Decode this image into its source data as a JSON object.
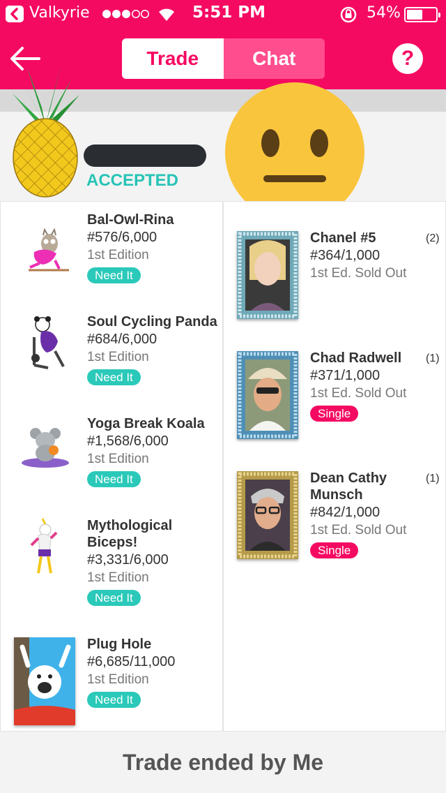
{
  "status_bar": {
    "carrier": "Valkyrie",
    "time": "5:51 PM",
    "battery": "54%",
    "battery_level": 0.54,
    "icons": [
      "back-to-app-icon",
      "signal-dots-icon",
      "wifi-icon",
      "orientation-lock-icon",
      "battery-icon"
    ]
  },
  "nav": {
    "back_icon": "back-arrow-icon",
    "tabs": [
      {
        "label": "Trade",
        "active": true
      },
      {
        "label": "Chat",
        "active": false
      }
    ],
    "help_label": "?"
  },
  "header": {
    "avatar_icon": "pineapple-avatar",
    "status": "ACCEPTED",
    "status_color": "#27c4b6",
    "reaction_icon": "neutral-face-emoji"
  },
  "left_items": [
    {
      "title": "Bal-Owl-Rina",
      "number": "#576/6,000",
      "edition": "1st Edition",
      "badge": "Need It"
    },
    {
      "title": "Soul Cycling Panda",
      "number": "#684/6,000",
      "edition": "1st Edition",
      "badge": "Need It"
    },
    {
      "title": "Yoga Break Koala",
      "number": "#1,568/6,000",
      "edition": "1st Edition",
      "badge": "Need It"
    },
    {
      "title": "Mythological",
      "title2": "Biceps!",
      "number": "#3,331/6,000",
      "edition": "1st Edition",
      "badge": "Need It"
    },
    {
      "title": "Plug Hole",
      "number": "#6,685/11,000",
      "edition": "1st Edition",
      "badge": "Need It"
    }
  ],
  "right_items": [
    {
      "title": "Chanel #5",
      "count": "(2)",
      "number": "#364/1,000",
      "edition": "1st Ed. Sold Out"
    },
    {
      "title": "Chad Radwell",
      "count": "(1)",
      "number": "#371/1,000",
      "edition": "1st Ed. Sold Out",
      "badge": "Single"
    },
    {
      "title": "Dean Cathy",
      "title2": "Munsch",
      "count": "(1)",
      "number": "#842/1,000",
      "edition": "1st Ed. Sold Out",
      "badge": "Single"
    }
  ],
  "footer": {
    "text": "Trade ended by Me"
  },
  "colors": {
    "brand": "#f50a62",
    "teal": "#2ac9b9"
  }
}
